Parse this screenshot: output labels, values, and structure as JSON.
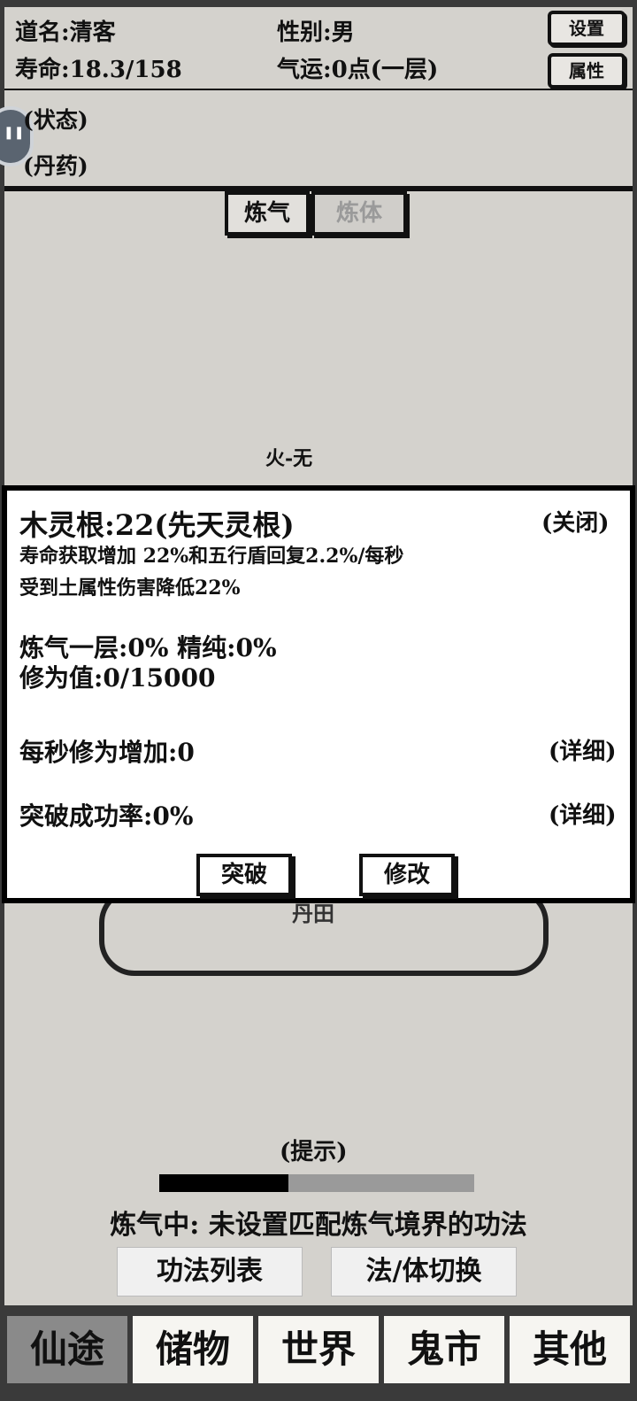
{
  "header": {
    "name": "道名:清客",
    "gender": "性别:男",
    "lifespan": "寿命:18.3/158",
    "luck": "气运:0点(一层)",
    "settings_label": "设置",
    "attributes_label": "属性"
  },
  "status": {
    "state_link": "(状态)",
    "pill_link": "(丹药)"
  },
  "tabs": {
    "qi": "炼气",
    "body": "炼体"
  },
  "map": {
    "fire_label": "火-无",
    "cloud_label": "丹田"
  },
  "panel": {
    "root": "木灵根:22(先天灵根)",
    "close": "(关闭)",
    "desc1": "寿命获取增加 22%和五行盾回复2.2%/每秒",
    "desc2": "受到土属性伤害降低22%",
    "realm": "炼气一层:0% 精纯:0%",
    "cultivation": "修为值:0/15000",
    "per_second": "每秒修为增加:0",
    "detail1": "(详细)",
    "breakthrough_rate": "突破成功率:0%",
    "detail2": "(详细)",
    "breakthrough_btn": "突破",
    "modify_btn": "修改"
  },
  "bottom": {
    "hint": "(提示)",
    "progress": 0.41,
    "training": "炼气中: 未设置匹配炼气境界的功法",
    "technique_list": "功法列表",
    "switch_mode": "法/体切换"
  },
  "nav": {
    "items": [
      "仙途",
      "储物",
      "世界",
      "鬼市",
      "其他"
    ],
    "active": "仙途"
  }
}
